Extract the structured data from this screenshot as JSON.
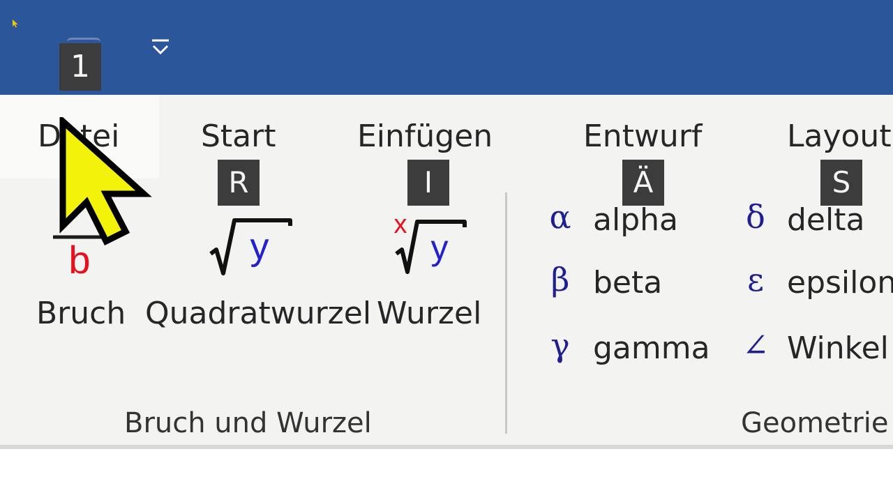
{
  "quick_access": {
    "keytip": "1"
  },
  "tabs": [
    {
      "label": "Datei",
      "keytip": ""
    },
    {
      "label": "Start",
      "keytip": "R"
    },
    {
      "label": "Einfügen",
      "keytip": "I"
    },
    {
      "label": "Entwurf",
      "keytip": "Ä"
    },
    {
      "label": "Layout",
      "keytip": "S"
    }
  ],
  "groups": {
    "fraction_root": {
      "label": "Bruch und Wurzel",
      "commands": [
        {
          "label": "Bruch",
          "icon": "fraction-icon",
          "icon_text": "b"
        },
        {
          "label": "Quadratwurzel",
          "icon": "square-root-icon",
          "icon_text": "y"
        },
        {
          "label": "Wurzel",
          "icon": "nth-root-icon",
          "icon_text": "y",
          "index_text": "x"
        }
      ]
    },
    "symbols": {
      "items": [
        {
          "symbol": "α",
          "name": "alpha"
        },
        {
          "symbol": "β",
          "name": "beta"
        },
        {
          "symbol": "γ",
          "name": "gamma"
        },
        {
          "symbol": "δ",
          "name": "delta"
        },
        {
          "symbol": "ε",
          "name": "epsilon"
        },
        {
          "symbol": "∠",
          "name": "Winkel"
        }
      ]
    },
    "geometry": {
      "label": "Geometrie"
    }
  },
  "colors": {
    "title_bar": "#2b579a",
    "ribbon": "#f3f3f1",
    "keytip": "#3c3c3c",
    "symbol": "#1f1f8f",
    "root_variable": "#2222cc",
    "denominator": "#e8101c",
    "cursor": "#f2f20a"
  },
  "cursor_icon": "yellow-arrow-pointer-icon"
}
